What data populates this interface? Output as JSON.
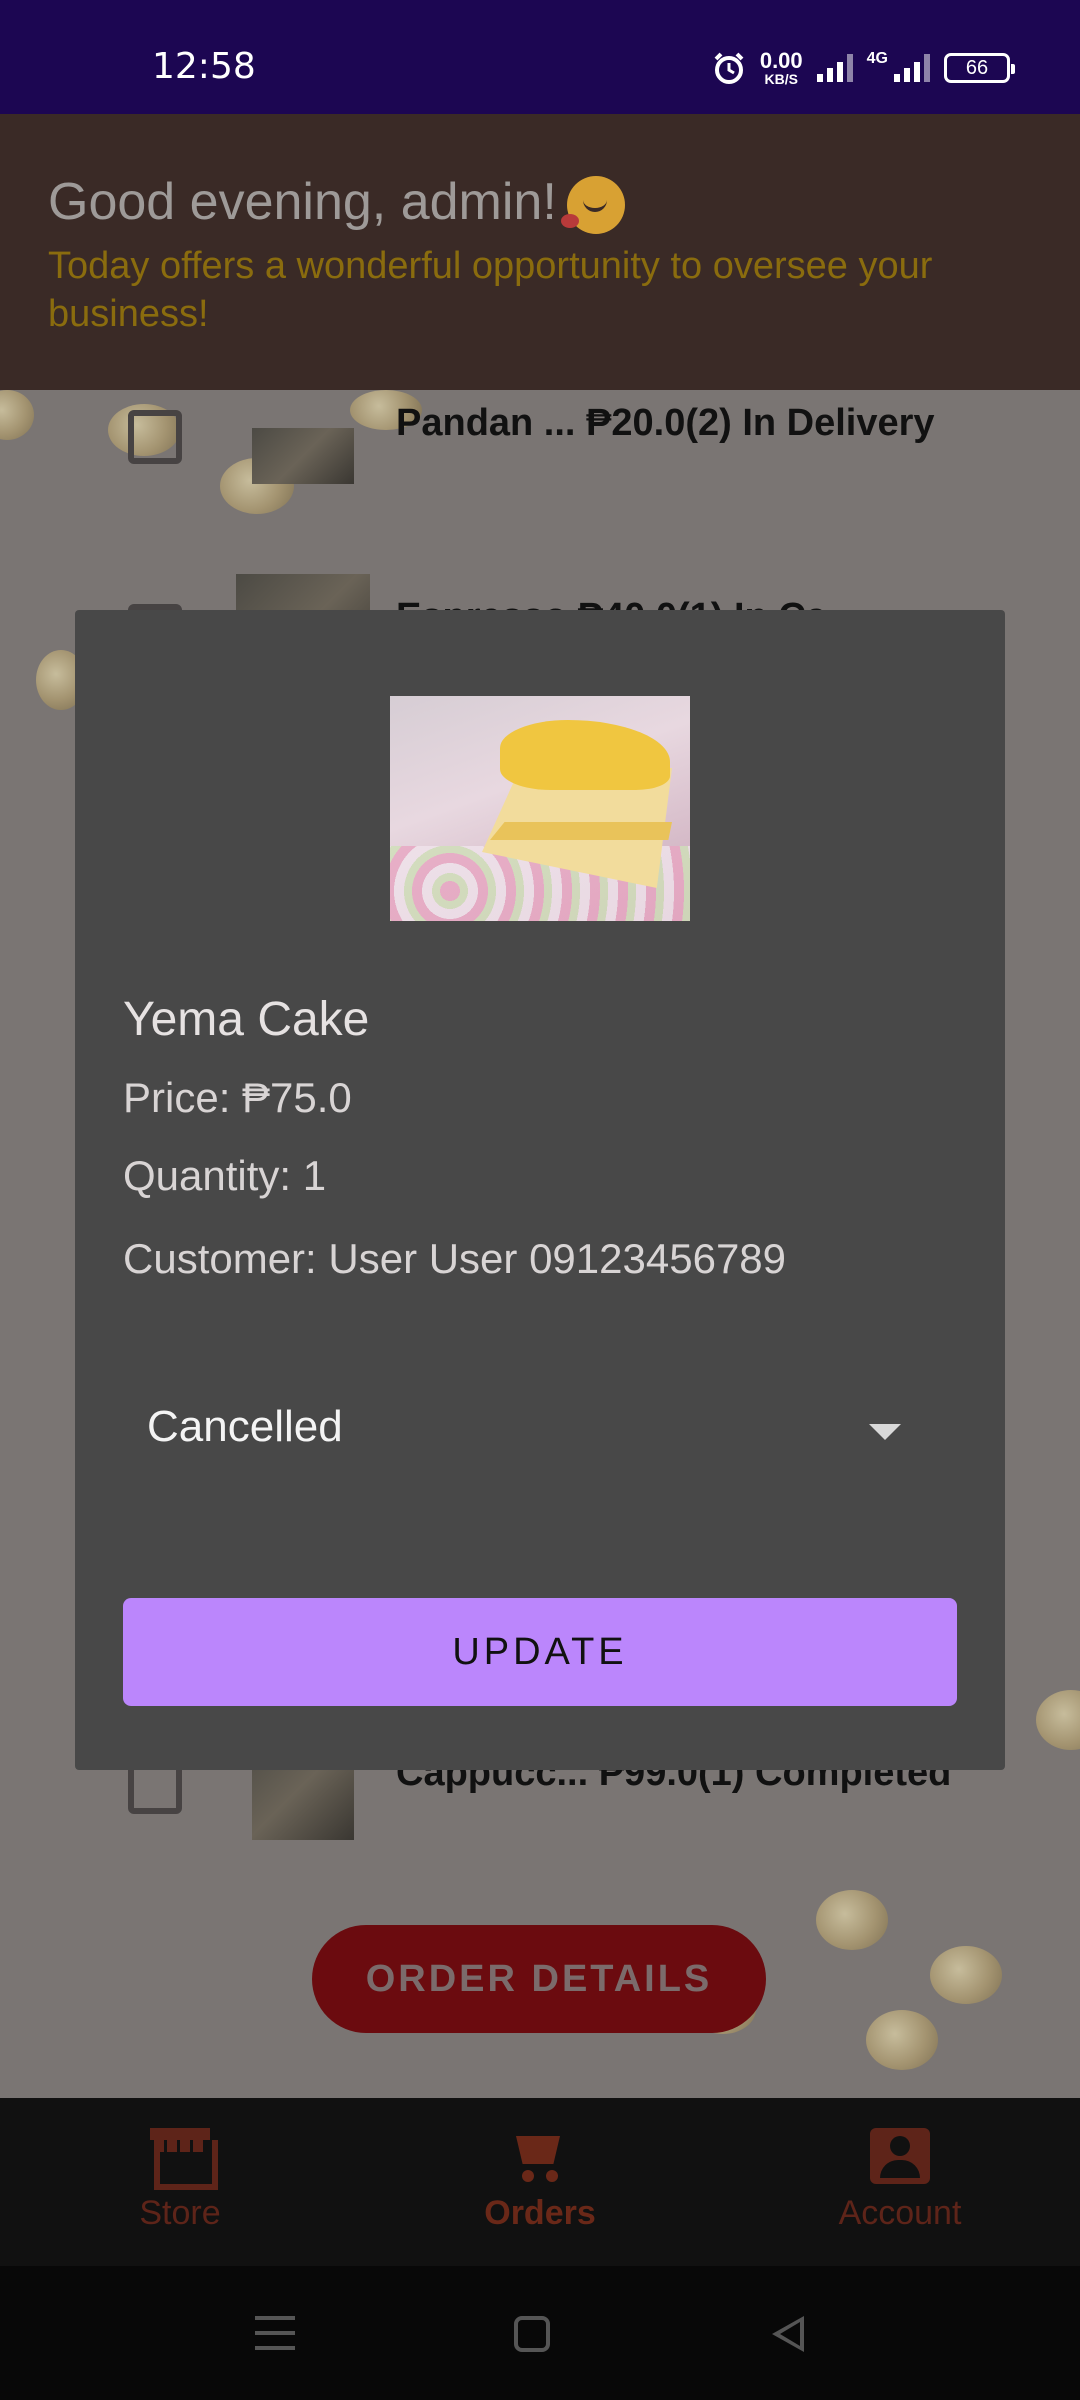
{
  "status_bar": {
    "time": "12:58",
    "net_speed_value": "0.00",
    "net_speed_unit": "KB/S",
    "network_type": "4G",
    "battery": "66"
  },
  "header": {
    "greeting": "Good evening, admin!",
    "subtitle": "Today offers a wonderful opportunity to oversee your business!"
  },
  "orders": {
    "rows": [
      {
        "text": "Pandan ...  ₱20.0(2)  In Delivery"
      },
      {
        "text": "Espresso  ₱40.0(1)  In Ca..."
      },
      {
        "text": "Cappucc... ₱99.0(1)  Completed"
      }
    ],
    "order_details_label": "ORDER DETAILS"
  },
  "dialog": {
    "product_name": "Yema Cake",
    "price": "Price: ₱75.0",
    "quantity": "Quantity: 1",
    "customer": "Customer: User User 09123456789",
    "status_selected": "Cancelled",
    "update_label": "UPDATE"
  },
  "bottom_nav": {
    "items": [
      {
        "label": "Store",
        "icon": "store-icon"
      },
      {
        "label": "Orders",
        "icon": "cart-icon"
      },
      {
        "label": "Account",
        "icon": "account-icon"
      }
    ],
    "active": "Orders"
  },
  "colors": {
    "status_bar": "#1c0652",
    "header": "#3a2a26",
    "subtitle": "#8a6c0e",
    "dialog": "#484848",
    "update_button": "#bb86fc",
    "order_details_button": "#6b0b0f"
  }
}
